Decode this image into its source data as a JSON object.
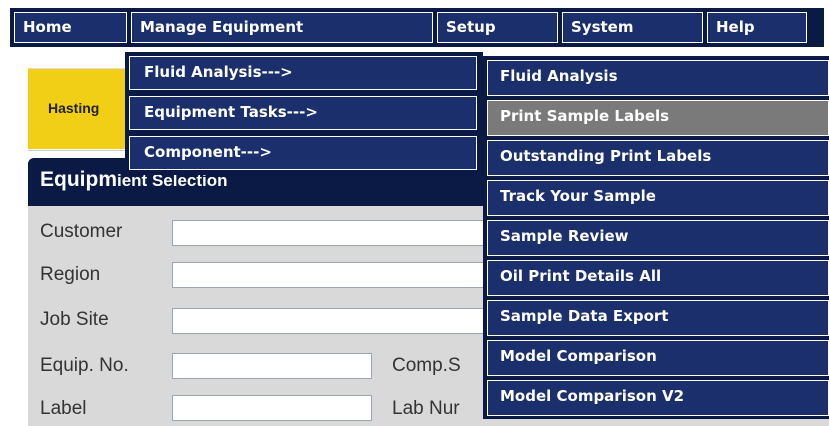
{
  "menubar": {
    "items": [
      {
        "label": "Home"
      },
      {
        "label": "Manage Equipment"
      },
      {
        "label": "Setup"
      },
      {
        "label": "System"
      },
      {
        "label": "Help"
      }
    ]
  },
  "submenu": {
    "items": [
      {
        "label": "Fluid Analysis--->"
      },
      {
        "label": "Equipment Tasks--->"
      },
      {
        "label": "Component--->"
      }
    ]
  },
  "flyout": {
    "items": [
      {
        "label": "Fluid Analysis"
      },
      {
        "label": "Print Sample Labels",
        "hover": true
      },
      {
        "label": "Outstanding Print Labels"
      },
      {
        "label": "Track Your Sample"
      },
      {
        "label": "Sample Review"
      },
      {
        "label": "Oil Print Details All"
      },
      {
        "label": "Sample Data Export"
      },
      {
        "label": "Model Comparison"
      },
      {
        "label": "Model Comparison V2"
      }
    ]
  },
  "logo": {
    "text_partial": "Hasting"
  },
  "panel": {
    "title_partial": "Equipm",
    "title_tail": "ient Selection",
    "fields": [
      {
        "label": "Customer"
      },
      {
        "label": "Region"
      },
      {
        "label": "Job Site"
      },
      {
        "label": "Equip. No."
      },
      {
        "label": "Label"
      }
    ],
    "right_labels": [
      {
        "label": "Comp.S"
      },
      {
        "label": "Lab Nur"
      }
    ]
  },
  "colors": {
    "menu_dark": "#0b1a45",
    "menu_item": "#1a2f6b",
    "hover": "#7a7a7a",
    "logo_yellow": "#f2cf17",
    "panel_gray": "#d9d9d9"
  }
}
